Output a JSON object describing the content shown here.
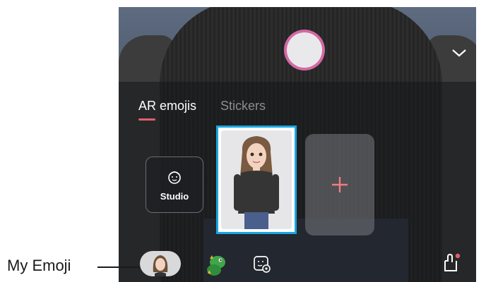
{
  "tabs": [
    {
      "label": "AR emojis",
      "active": true
    },
    {
      "label": "Stickers",
      "active": false
    }
  ],
  "studio": {
    "label": "Studio",
    "icon": "face-outline-icon"
  },
  "add_card": {
    "icon": "plus-icon"
  },
  "bottom_bar": {
    "icons": [
      "my-emoji-avatar-icon",
      "dinosaur-emoji-icon",
      "sticker-settings-icon",
      "store-bag-icon"
    ]
  },
  "callout": {
    "label": "My Emoji"
  },
  "colors": {
    "accent_pink": "#e0606a",
    "selection_blue": "#19a6e0",
    "capture_ring": "#d36aa3"
  }
}
